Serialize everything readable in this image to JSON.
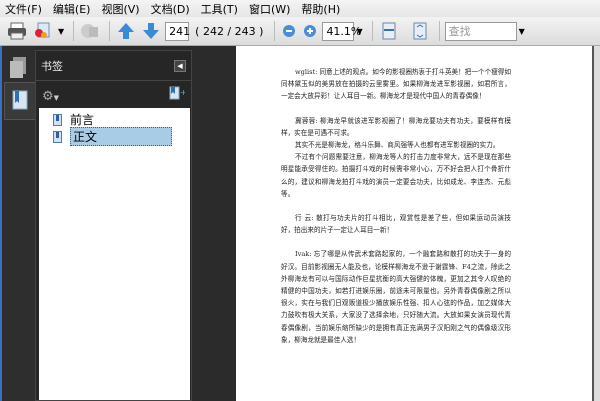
{
  "menu": [
    "文件(F)",
    "编辑(E)",
    "视图(V)",
    "文档(D)",
    "工具(T)",
    "窗口(W)",
    "帮助(H)"
  ],
  "toolbar": {
    "current_page": "241",
    "page_count": "( 242 / 243 )",
    "zoom": "41.1%",
    "search_placeholder": "查找"
  },
  "panel": {
    "title": "书签",
    "bookmarks": [
      {
        "label": "前言",
        "selected": false
      },
      {
        "label": "正文",
        "selected": true
      }
    ]
  },
  "document": {
    "paragraphs": [
      "wglist: 同意上述的观点。如今的影视圈热衷于打斗英美！把一个个瘦得如同林黛玉似的美男放在拍摄的云里雾里。如果柳海龙进军影视圈，如君所言，一定会大放异彩！让人耳目一新。柳海龙才是现代中国人的青春偶像！",
      "冀蓉蓉: 柳海龙早就该进军影视圈了！柳海龙要功夫有功夫，要模样有模样，实在是可遇不可求。",
      "其实不光是柳海龙，格斗乐舞、商风强等人也都有进军影视圈的实力。",
      "不过有个问题需要注意，柳海龙等人的打击力度非常大，远不是现在那些明星能承受得住的。拍摄打斗戏的时候需非常小心，万不好会把人打个骨折什么的，建议和柳海龙拍打斗戏的演员一定要会功夫，比如成龙、李连杰、元彪等。",
      "行 云: 散打与功夫片的打斗相比，观赏性是差了些，但如果运动员演技好，拍出来的片子一定让人耳目一新！",
      "Ivak: 忘了哪是从传武术套路起家的，一个融套路和散打的功夫于一身的好汉。目前影视圈无人能及也，论模样柳海龙不逊于谢霆锋、F4之流，除此之外柳海龙有可以与国际动作巨星抗衡的高大强健的体魄，更加之其令人叹绝的精健的中国功夫，如若打进娱乐圈，前途未可限量也。另外青春偶像剧之所以很火，实在与我们日观贩道极少播放娱乐性强、扣人心弦的作品，加之媒体大力鼓吹有极大关系，大家没了选择余地，只好随大流。大放如果女演员现代青春偶像剧，当前娱乐缩所缺少的是拥有真正充满男子汉阳刚之气的偶像级汉形象，柳海龙就是最佳人选！"
    ]
  }
}
